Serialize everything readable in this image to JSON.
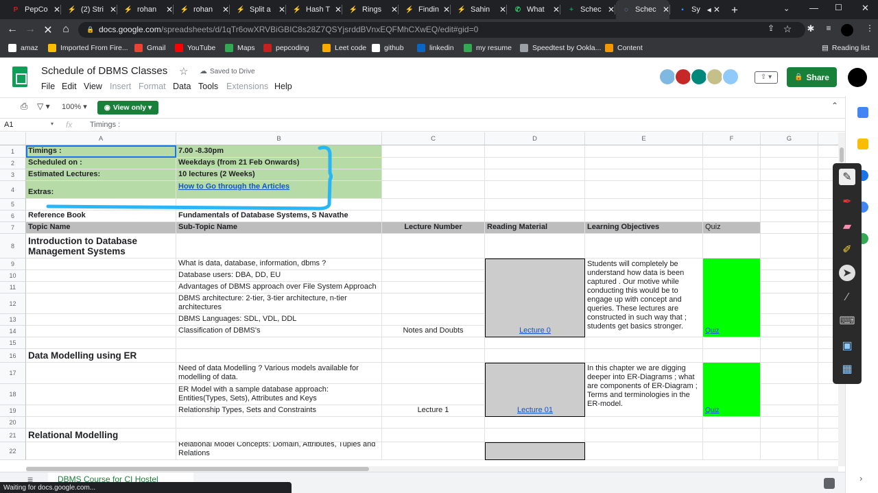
{
  "browser": {
    "tabs": [
      {
        "title": "PepCo",
        "color": "#c5221f",
        "glyph": "P"
      },
      {
        "title": "(2) Stri",
        "color": "#f9ab00",
        "glyph": "⚡"
      },
      {
        "title": "rohan",
        "color": "#f9ab00",
        "glyph": "⚡"
      },
      {
        "title": "rohan",
        "color": "#f9ab00",
        "glyph": "⚡"
      },
      {
        "title": "Split a",
        "color": "#f9ab00",
        "glyph": "⚡"
      },
      {
        "title": "Hash T",
        "color": "#f9ab00",
        "glyph": "⚡"
      },
      {
        "title": "Rings",
        "color": "#f9ab00",
        "glyph": "⚡"
      },
      {
        "title": "Findin",
        "color": "#f9ab00",
        "glyph": "⚡"
      },
      {
        "title": "Sahin",
        "color": "#f9ab00",
        "glyph": "⚡"
      },
      {
        "title": "What",
        "color": "#25d366",
        "glyph": "✆"
      },
      {
        "title": "Schec",
        "color": "#0f9d58",
        "glyph": "+"
      },
      {
        "title": "Schec",
        "color": "#8ab4f8",
        "glyph": "◌"
      },
      {
        "title": "Sy",
        "color": "#2d8cff",
        "glyph": "▪"
      }
    ],
    "new_tab": "+",
    "url_domain": "docs.google.com",
    "url_path": "/spreadsheets/d/1qTr6owXRVBiGBIC8s28Z7QSYjsrddBVnxEQFMhCXwEQ/edit#gid=0",
    "bookmarks": [
      {
        "label": "amaz",
        "color": "#ffffff"
      },
      {
        "label": "Imported From Fire...",
        "color": "#fbbc04"
      },
      {
        "label": "Gmail",
        "color": "#ea4335"
      },
      {
        "label": "YouTube",
        "color": "#ff0000"
      },
      {
        "label": "Maps",
        "color": "#34a853"
      },
      {
        "label": "pepcoding",
        "color": "#c5221f"
      },
      {
        "label": "Leet code",
        "color": "#f9ab00"
      },
      {
        "label": "github",
        "color": "#ffffff"
      },
      {
        "label": "linkedin",
        "color": "#0a66c2"
      },
      {
        "label": "my resume",
        "color": "#34a853"
      },
      {
        "label": "Speedtest by Ookla...",
        "color": "#9aa0a6"
      },
      {
        "label": "Content",
        "color": "#f29900"
      }
    ],
    "reading_list": "Reading list",
    "status": "Waiting for docs.google.com..."
  },
  "sheets": {
    "doc_title": "Schedule of DBMS Classes",
    "saved_status": "Saved to Drive",
    "menus": [
      "File",
      "Edit",
      "View",
      "Insert",
      "Format",
      "Data",
      "Tools",
      "Extensions",
      "Help"
    ],
    "disabled_menus": [
      "Insert",
      "Format",
      "Extensions"
    ],
    "share_label": "Share",
    "zoom": "100%",
    "view_only": "View only",
    "name_box": "A1",
    "formula_value": "Timings :",
    "sheet_tab": "DBMS Course for CI Hostel"
  },
  "grid": {
    "columns": [
      "A",
      "B",
      "C",
      "D",
      "E",
      "F",
      "G"
    ],
    "rows": [
      {
        "n": "1",
        "A": "Timings :",
        "B": "7.00 -8.30pm"
      },
      {
        "n": "2",
        "A": "Scheduled on :",
        "B": "Weekdays (from 21 Feb Onwards)"
      },
      {
        "n": "3",
        "A": "Estimated Lectures:",
        "B": "10 lectures (2 Weeks)"
      },
      {
        "n": "4",
        "A": "Extras:",
        "B": "How to Go through the Articles"
      },
      {
        "n": "5"
      },
      {
        "n": "6",
        "A": "Reference Book",
        "B": "Fundamentals of Database Systems, S Navathe"
      },
      {
        "n": "7",
        "A": "Topic Name",
        "B": "Sub-Topic Name",
        "C": "Lecture Number",
        "D": "Reading Material",
        "E": "Learning Objectives",
        "F": "Quiz"
      },
      {
        "n": "8",
        "A": "Introduction to Database Management Systems"
      },
      {
        "n": "9",
        "B": "What is data, database, information, dbms ?"
      },
      {
        "n": "10",
        "B": "Database users: DBA, DD, EU"
      },
      {
        "n": "11",
        "B": "Advantages of DBMS approach over File System Approach"
      },
      {
        "n": "12",
        "B": "DBMS architecture: 2-tier, 3-tier architecture, n-tier architectures"
      },
      {
        "n": "13",
        "B": "DBMS Languages: SDL, VDL, DDL"
      },
      {
        "n": "14",
        "B": "Classification of DBMS's",
        "C": "Notes and Doubts"
      },
      {
        "n": "15"
      },
      {
        "n": "16",
        "A": "Data Modelling using ER"
      },
      {
        "n": "17",
        "B": "Need of data Modelling ? Various models available for modelling of data."
      },
      {
        "n": "18",
        "B": "ER Model with a sample database approach: Entities(Types, Sets), Attributes and Keys"
      },
      {
        "n": "19",
        "B": "Relationship Types, Sets and Constraints",
        "C": "Lecture 1"
      },
      {
        "n": "20"
      },
      {
        "n": "21",
        "A": "Relational Modelling"
      },
      {
        "n": "22",
        "B": "Relational Model Concepts: Domain, Attributes, Tuples and Relations"
      }
    ],
    "merged": {
      "lecture0_link": "Lecture 0",
      "lecture01_link": "Lecture 01",
      "objectives1": "Students will completely be understand how data is been captured . Our motive while conducting this would be to engage up with concept and queries. These lectures are constructed in such way that ; students get basics stronger.",
      "objectives2": "In this chapter we are digging deeper into ER-Diagrams ; what are components of ER-Diagram ; Terms and terminologies in the ER-model.",
      "quiz1": "Quiz",
      "quiz2": "Quiz"
    }
  },
  "colors": {
    "header_green": "#b7dba7",
    "header_grey": "#bdbdbd",
    "quiz_green": "#00ff00",
    "annotation_blue": "#29b6f6"
  }
}
